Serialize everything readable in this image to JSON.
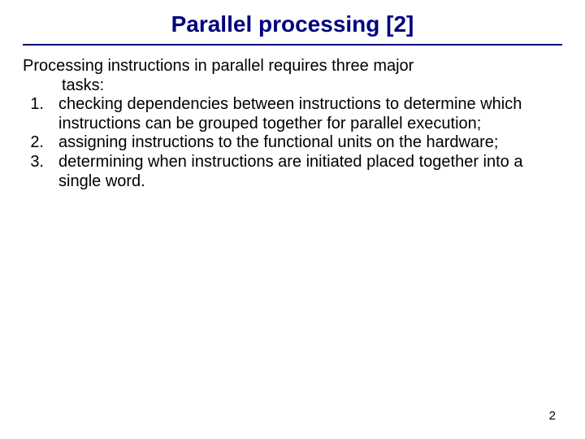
{
  "title": "Parallel processing [2]",
  "intro": {
    "line1": "Processing instructions in parallel requires three major",
    "line2": "tasks:"
  },
  "tasks": [
    {
      "num": "1.",
      "text": "checking dependencies between instructions to determine which instructions can be grouped together for parallel execution;"
    },
    {
      "num": "2.",
      "text": "assigning instructions to the functional units on the hardware;"
    },
    {
      "num": "3.",
      "text": "determining when instructions are initiated placed together into a single word."
    }
  ],
  "page_number": "2"
}
